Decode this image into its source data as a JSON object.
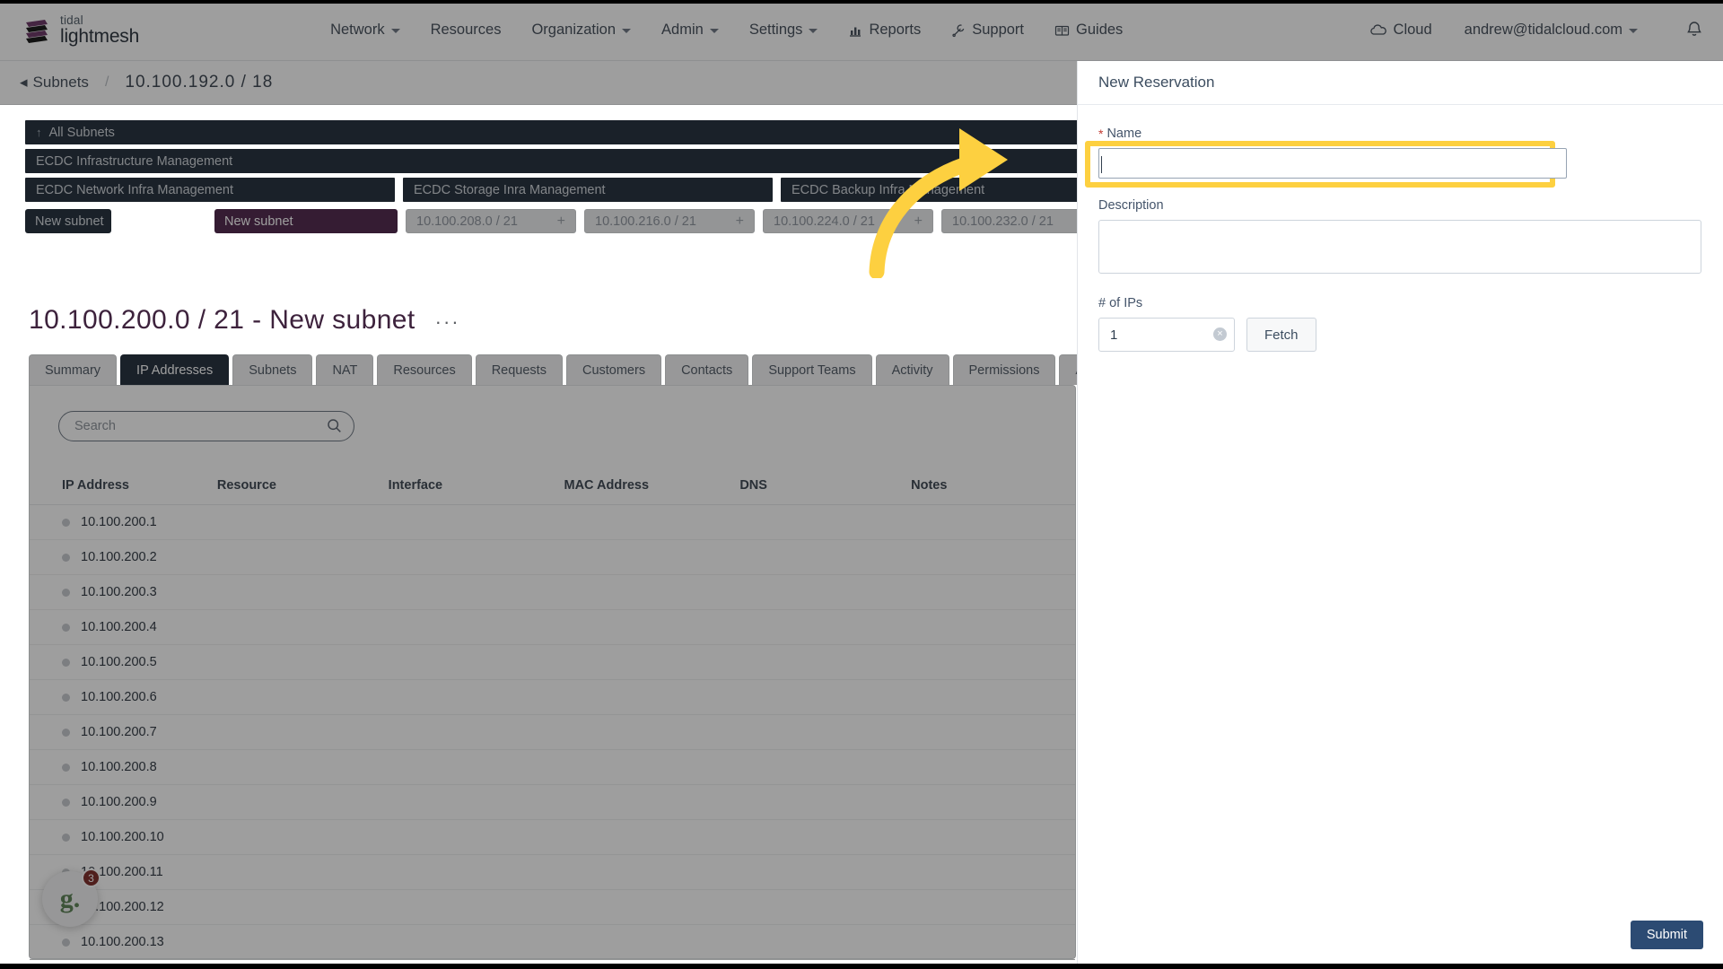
{
  "topnav": {
    "logo": {
      "line1": "tidal",
      "line2": "lightmesh"
    },
    "items": [
      {
        "label": "Network",
        "icon": "chevron-down-icon",
        "has_caret": true
      },
      {
        "label": "Resources",
        "icon": "",
        "has_caret": false
      },
      {
        "label": "Organization",
        "icon": "chevron-down-icon",
        "has_caret": true
      },
      {
        "label": "Admin",
        "icon": "chevron-down-icon",
        "has_caret": true
      },
      {
        "label": "Settings",
        "icon": "chevron-down-icon",
        "has_caret": true
      },
      {
        "label": "Reports",
        "icon": "bar-chart-icon",
        "has_caret": false
      },
      {
        "label": "Support",
        "icon": "wrench-icon",
        "has_caret": false
      },
      {
        "label": "Guides",
        "icon": "book-icon",
        "has_caret": false
      },
      {
        "label": "Cloud",
        "icon": "cloud-icon",
        "has_caret": false
      }
    ],
    "user": {
      "email": "andrew@tidalcloud.com",
      "caret": true
    },
    "notifications_icon": "bell-icon"
  },
  "breadcrumb": {
    "back_label": "Subnets",
    "separator": "/",
    "current": "10.100.192.0 / 18"
  },
  "hierarchy": {
    "all_subnets": "All Subnets",
    "level2": "ECDC Infrastructure Management",
    "level3": [
      "ECDC Network Infra Management",
      "ECDC Storage Inra Management",
      "ECDC Backup Infra Management"
    ],
    "chips": [
      {
        "label": "New subnet",
        "style": "navy",
        "plus": ""
      },
      {
        "label": "New subnet",
        "style": "purple",
        "plus": ""
      },
      {
        "label": "10.100.208.0 / 21",
        "style": "light",
        "plus": "+"
      },
      {
        "label": "10.100.216.0 / 21",
        "style": "light",
        "plus": "+"
      },
      {
        "label": "10.100.224.0 / 21",
        "style": "light",
        "plus": "+"
      },
      {
        "label": "10.100.232.0 / 21",
        "style": "light",
        "plus": "+"
      }
    ]
  },
  "page": {
    "title": "10.100.200.0 / 21 - New subnet",
    "menu_glyph": "···"
  },
  "tabs": [
    {
      "label": "Summary",
      "active": false
    },
    {
      "label": "IP Addresses",
      "active": true
    },
    {
      "label": "Subnets",
      "active": false
    },
    {
      "label": "NAT",
      "active": false
    },
    {
      "label": "Resources",
      "active": false
    },
    {
      "label": "Requests",
      "active": false
    },
    {
      "label": "Customers",
      "active": false
    },
    {
      "label": "Contacts",
      "active": false
    },
    {
      "label": "Support Teams",
      "active": false
    },
    {
      "label": "Activity",
      "active": false
    },
    {
      "label": "Permissions",
      "active": false
    },
    {
      "label": "Alerts",
      "active": false
    }
  ],
  "search": {
    "placeholder": "Search",
    "value": "",
    "icon": "search-icon"
  },
  "table": {
    "columns": [
      "IP Address",
      "Resource",
      "Interface",
      "MAC Address",
      "DNS",
      "Notes"
    ],
    "rows": [
      {
        "ip": "10.100.200.1",
        "resource": "",
        "interface": "",
        "mac": "",
        "dns": "",
        "notes": ""
      },
      {
        "ip": "10.100.200.2",
        "resource": "",
        "interface": "",
        "mac": "",
        "dns": "",
        "notes": ""
      },
      {
        "ip": "10.100.200.3",
        "resource": "",
        "interface": "",
        "mac": "",
        "dns": "",
        "notes": ""
      },
      {
        "ip": "10.100.200.4",
        "resource": "",
        "interface": "",
        "mac": "",
        "dns": "",
        "notes": ""
      },
      {
        "ip": "10.100.200.5",
        "resource": "",
        "interface": "",
        "mac": "",
        "dns": "",
        "notes": ""
      },
      {
        "ip": "10.100.200.6",
        "resource": "",
        "interface": "",
        "mac": "",
        "dns": "",
        "notes": ""
      },
      {
        "ip": "10.100.200.7",
        "resource": "",
        "interface": "",
        "mac": "",
        "dns": "",
        "notes": ""
      },
      {
        "ip": "10.100.200.8",
        "resource": "",
        "interface": "",
        "mac": "",
        "dns": "",
        "notes": ""
      },
      {
        "ip": "10.100.200.9",
        "resource": "",
        "interface": "",
        "mac": "",
        "dns": "",
        "notes": ""
      },
      {
        "ip": "10.100.200.10",
        "resource": "",
        "interface": "",
        "mac": "",
        "dns": "",
        "notes": ""
      },
      {
        "ip": "10.100.200.11",
        "resource": "",
        "interface": "",
        "mac": "",
        "dns": "",
        "notes": ""
      },
      {
        "ip": "10.100.200.12",
        "resource": "",
        "interface": "",
        "mac": "",
        "dns": "",
        "notes": ""
      },
      {
        "ip": "10.100.200.13",
        "resource": "",
        "interface": "",
        "mac": "",
        "dns": "",
        "notes": ""
      }
    ]
  },
  "right_panel": {
    "title": "New Reservation",
    "name": {
      "label": "Name",
      "required_marker": "*",
      "value": "",
      "placeholder": ""
    },
    "description": {
      "label": "Description",
      "value": "",
      "placeholder": ""
    },
    "num_ips": {
      "label": "# of IPs",
      "value": "1",
      "clear_glyph": "×"
    },
    "fetch_label": "Fetch",
    "submit_label": "Submit"
  },
  "chat_widget": {
    "glyph": "g.",
    "badge": "3"
  },
  "colors": {
    "navy": "#22364e",
    "purple": "#6d2468",
    "title_purple": "#7b2d7a",
    "highlight_yellow": "#fdd040",
    "submit_blue": "#2c4b73",
    "required_red": "#c23b32",
    "badge_red": "#b3251f",
    "chat_green": "#4b8f3f"
  }
}
